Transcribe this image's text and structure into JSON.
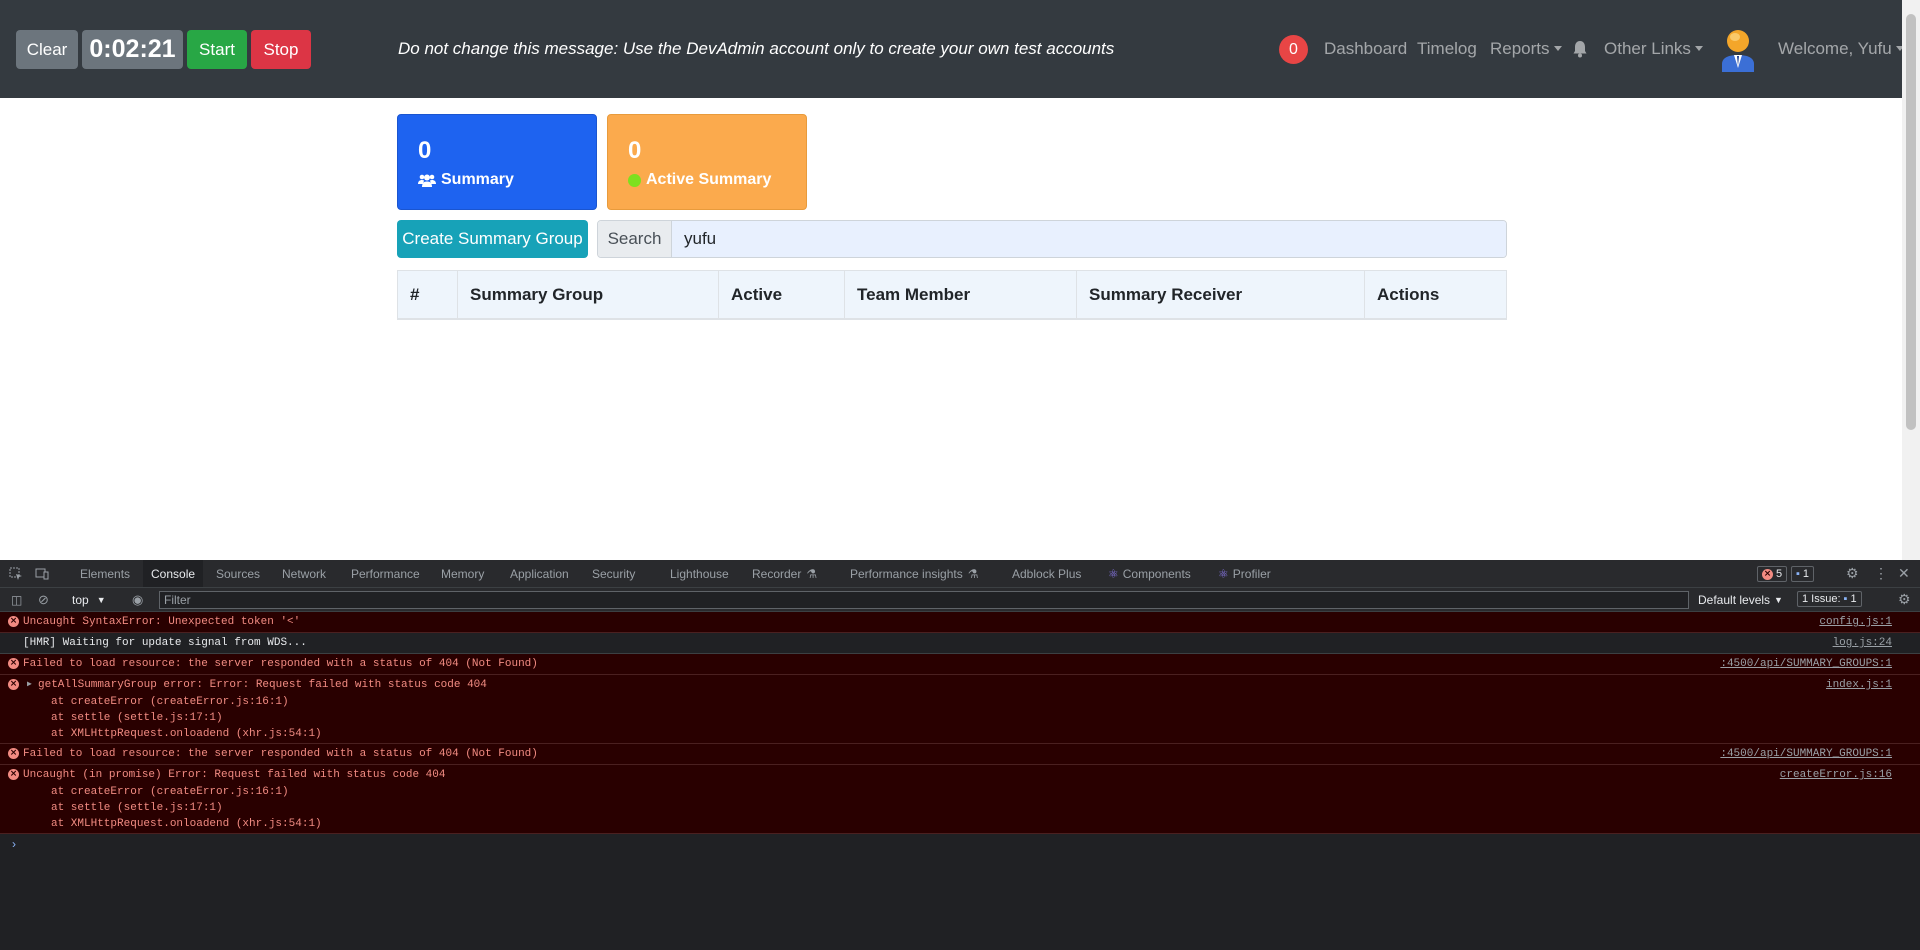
{
  "navbar": {
    "clear_label": "Clear",
    "timer": "0:02:21",
    "start_label": "Start",
    "stop_label": "Stop",
    "banner": "Do not change this message: Use the DevAdmin account only to create your own test accounts",
    "notification_count": "0",
    "links": {
      "dashboard": "Dashboard",
      "timelog": "Timelog",
      "reports": "Reports",
      "other_links": "Other Links",
      "welcome": "Welcome, Yufu"
    }
  },
  "cards": {
    "summary": {
      "count": "0",
      "label": "Summary"
    },
    "active_summary": {
      "count": "0",
      "label": "Active Summary"
    }
  },
  "create_button": "Create Summary Group",
  "search": {
    "label": "Search",
    "value": "yufu"
  },
  "table": {
    "headers": [
      "#",
      "Summary Group",
      "Active",
      "Team Member",
      "Summary Receiver",
      "Actions"
    ]
  },
  "devtools": {
    "tabs": [
      "Elements",
      "Console",
      "Sources",
      "Network",
      "Performance",
      "Memory",
      "Application",
      "Security",
      "Lighthouse",
      "Recorder",
      "Performance insights",
      "Adblock Plus",
      "Components",
      "Profiler"
    ],
    "error_count": "5",
    "message_count": "1",
    "context": "top",
    "filter_placeholder": "Filter",
    "levels": "Default levels",
    "issues_label": "1 Issue:",
    "issues_count": "1",
    "console_rows": [
      {
        "type": "error",
        "message": "Uncaught SyntaxError: Unexpected token '<'",
        "source": "config.js:1",
        "stack": []
      },
      {
        "type": "info",
        "message": "[HMR] Waiting for update signal from WDS...",
        "source": "log.js:24",
        "stack": []
      },
      {
        "type": "error",
        "message": "Failed to load resource: the server responded with a status of 404 (Not Found)",
        "source": ":4500/api/SUMMARY_GROUPS:1",
        "stack": []
      },
      {
        "type": "error",
        "message": "getAllSummaryGroup error: Error: Request failed with status code 404",
        "source": "index.js:1",
        "stack": [
          "at createError (createError.js:16:1)",
          "at settle (settle.js:17:1)",
          "at XMLHttpRequest.onloadend (xhr.js:54:1)"
        ]
      },
      {
        "type": "error",
        "message": "Failed to load resource: the server responded with a status of 404 (Not Found)",
        "source": ":4500/api/SUMMARY_GROUPS:1",
        "stack": []
      },
      {
        "type": "error",
        "message": "Uncaught (in promise) Error: Request failed with status code 404",
        "source": "createError.js:16",
        "stack": [
          "at createError (createError.js:16:1)",
          "at settle (settle.js:17:1)",
          "at XMLHttpRequest.onloadend (xhr.js:54:1)"
        ]
      }
    ]
  }
}
